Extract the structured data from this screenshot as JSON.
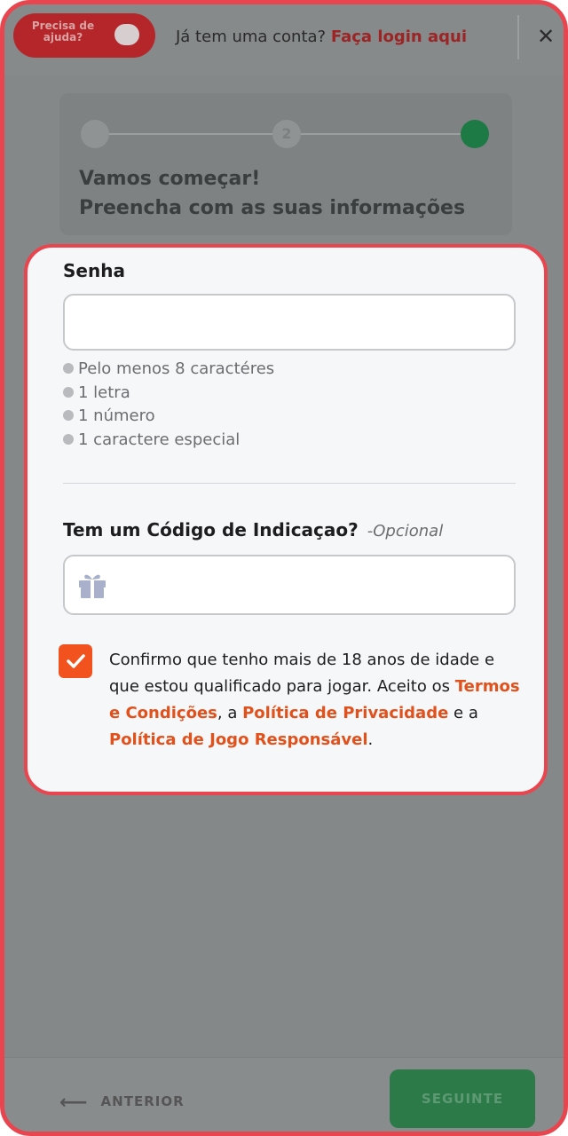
{
  "header": {
    "help_label": "Precisa de ajuda?",
    "have_account_text": "Já tem uma conta?",
    "login_link": "Faça login aqui",
    "close_icon": "close-icon"
  },
  "stepper": {
    "step2_label": "2",
    "title_line1": "Vamos começar!",
    "title_line2": "Preencha com as suas informações"
  },
  "password": {
    "label": "Senha",
    "value": "",
    "requirements": [
      "Pelo menos 8 caractéres",
      "1 letra",
      "1 número",
      "1 caractere especial"
    ]
  },
  "referral": {
    "label": "Tem um Código de Indicaçao?",
    "optional": "-Opcional",
    "value": "",
    "icon": "gift-icon"
  },
  "consent": {
    "checked": true,
    "text1": "Confirmo que tenho mais de 18 anos de idade e que estou qualificado para jogar. Aceito os ",
    "terms_link": "Termos e Condições",
    "text2": ", a ",
    "privacy_link": "Política de Privacidade",
    "text3": " e a ",
    "responsible_link": "Política de Jogo Responsável",
    "text4": "."
  },
  "footer": {
    "back_label": "ANTERIOR",
    "next_label": "SEGUINTE"
  },
  "colors": {
    "accent": "#e2511b",
    "frame": "#e8454f",
    "success": "#1d7a45"
  }
}
